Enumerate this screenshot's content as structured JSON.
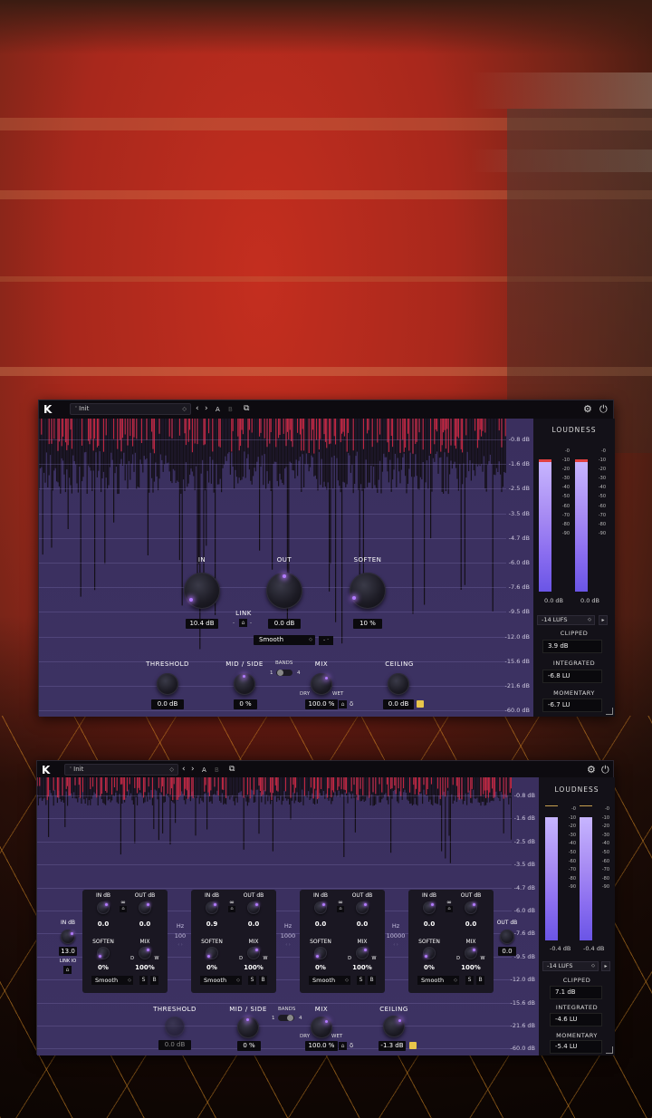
{
  "colors": {
    "accent": "#b27bff",
    "meter_top": "#c7b5ff",
    "peak": "#e04040",
    "background_view": "#3b3060"
  },
  "icons": [
    "logo-icon",
    "chevron-left-icon",
    "chevron-right-icon",
    "copy-icon",
    "gear-icon",
    "power-icon",
    "link-icon",
    "delta-icon",
    "resize-icon"
  ],
  "window1": {
    "logo": "K",
    "preset_name": "Init",
    "ab_a": "A",
    "ab_b": "B",
    "scale": [
      "-0.8 dB",
      "-1.6 dB",
      "-2.5 dB",
      "-3.5 dB",
      "-4.7 dB",
      "-6.0 dB",
      "-7.6 dB",
      "-9.5 dB",
      "-12.0 dB",
      "-15.6 dB",
      "-21.6 dB",
      "-60.0 dB"
    ],
    "knobs": {
      "in_label": "IN",
      "in_value": "10.4 dB",
      "out_label": "OUT",
      "out_value": "0.0 dB",
      "soften_label": "SOFTEN",
      "soften_value": "10 %",
      "link_label": "LINK"
    },
    "mode": "Smooth",
    "bottom": {
      "threshold_label": "THRESHOLD",
      "threshold_value": "0.0 dB",
      "midside_label": "MID / SIDE",
      "midside_value": "0 %",
      "bands_label": "BANDS",
      "bands_min": "1",
      "bands_max": "4",
      "mix_label": "MIX",
      "mix_value": "100.0 %",
      "dry": "DRY",
      "wet": "WET",
      "ceiling_label": "CEILING",
      "ceiling_value": "0.0 dB"
    },
    "loudness": {
      "title": "LOUDNESS",
      "ticks": [
        "-0",
        "-10",
        "-20",
        "-30",
        "-40",
        "-50",
        "-60",
        "-70",
        "-80",
        "-90"
      ],
      "left_value": "0.0 dB",
      "right_value": "0.0 dB",
      "target": "-14 LUFS",
      "clipped_label": "CLIPPED",
      "clipped_value": "3.9 dB",
      "integrated_label": "INTEGRATED",
      "integrated_value": "-6.8 LU",
      "momentary_label": "MOMENTARY",
      "momentary_value": "-6.7 LU"
    }
  },
  "window2": {
    "logo": "K",
    "preset_name": "Init",
    "ab_a": "A",
    "ab_b": "B",
    "scale": [
      "-0.8 dB",
      "-1.6 dB",
      "-2.5 dB",
      "-3.5 dB",
      "-4.7 dB",
      "-6.0 dB",
      "-7.6 dB",
      "-9.5 dB",
      "-12.0 dB",
      "-15.6 dB",
      "-21.6 dB",
      "-60.0 dB"
    ],
    "input": {
      "label": "IN dB",
      "value": "13.0",
      "link_label": "LINK IO"
    },
    "output": {
      "label": "OUT dB",
      "value": "0.0"
    },
    "bands": [
      {
        "in_label": "IN dB",
        "out_label": "OUT dB",
        "in_value": "0.0",
        "out_value": "0.0",
        "soften_label": "SOFTEN",
        "mix_label": "MIX",
        "soften_value": "0%",
        "mix_value": "100%",
        "d": "D",
        "w": "W",
        "mode": "Smooth",
        "s": "S",
        "b": "B"
      },
      {
        "in_label": "IN dB",
        "out_label": "OUT dB",
        "in_value": "0.9",
        "out_value": "0.0",
        "soften_label": "SOFTEN",
        "mix_label": "MIX",
        "soften_value": "0%",
        "mix_value": "100%",
        "d": "D",
        "w": "W",
        "mode": "Smooth",
        "s": "S",
        "b": "B"
      },
      {
        "in_label": "IN dB",
        "out_label": "OUT dB",
        "in_value": "0.0",
        "out_value": "0.0",
        "soften_label": "SOFTEN",
        "mix_label": "MIX",
        "soften_value": "0%",
        "mix_value": "100%",
        "d": "D",
        "w": "W",
        "mode": "Smooth",
        "s": "S",
        "b": "B"
      },
      {
        "in_label": "IN dB",
        "out_label": "OUT dB",
        "in_value": "0.0",
        "out_value": "0.0",
        "soften_label": "SOFTEN",
        "mix_label": "MIX",
        "soften_value": "0%",
        "mix_value": "100%",
        "d": "D",
        "w": "W",
        "mode": "Smooth",
        "s": "S",
        "b": "B"
      }
    ],
    "crossovers": [
      {
        "label": "Hz",
        "value": "100"
      },
      {
        "label": "Hz",
        "value": "1000"
      },
      {
        "label": "Hz",
        "value": "10000"
      }
    ],
    "bottom": {
      "threshold_label": "THRESHOLD",
      "threshold_value": "0.0 dB",
      "midside_label": "MID / SIDE",
      "midside_value": "0 %",
      "bands_label": "BANDS",
      "bands_min": "1",
      "bands_max": "4",
      "mix_label": "MIX",
      "mix_value": "100.0 %",
      "dry": "DRY",
      "wet": "WET",
      "ceiling_label": "CEILING",
      "ceiling_value": "-1.3 dB"
    },
    "loudness": {
      "title": "LOUDNESS",
      "ticks": [
        "-0",
        "-10",
        "-20",
        "-30",
        "-40",
        "-50",
        "-60",
        "-70",
        "-80",
        "-90"
      ],
      "left_value": "-0.4 dB",
      "right_value": "-0.4 dB",
      "target": "-14 LUFS",
      "clipped_label": "CLIPPED",
      "clipped_value": "7.1 dB",
      "integrated_label": "INTEGRATED",
      "integrated_value": "-4.6 LU",
      "momentary_label": "MOMENTARY",
      "momentary_value": "-5.4 LU"
    }
  }
}
